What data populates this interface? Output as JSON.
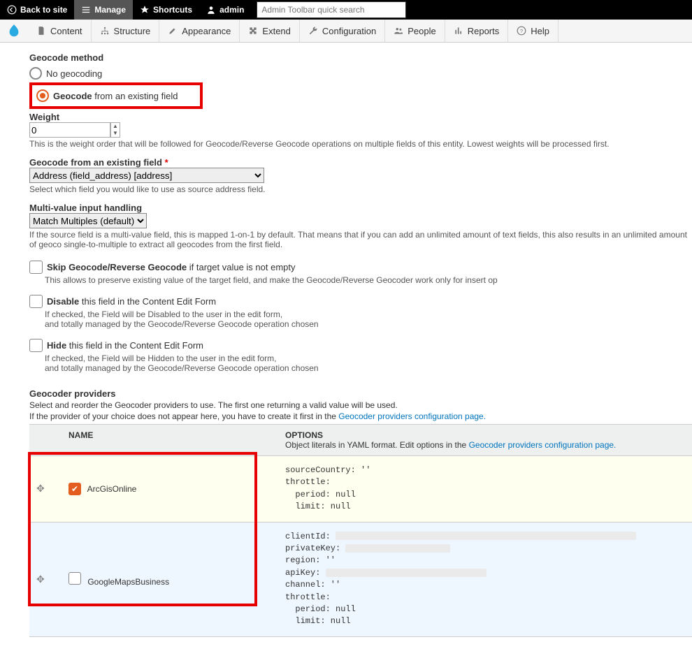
{
  "adminBar": {
    "back": "Back to site",
    "manage": "Manage",
    "shortcuts": "Shortcuts",
    "user": "admin",
    "searchPlaceholder": "Admin Toolbar quick search"
  },
  "tabs": {
    "content": "Content",
    "structure": "Structure",
    "appearance": "Appearance",
    "extend": "Extend",
    "configuration": "Configuration",
    "people": "People",
    "reports": "Reports",
    "help": "Help"
  },
  "geocodeMethod": {
    "label": "Geocode method",
    "noGeocoding": "No geocoding",
    "geocodeStrong": "Geocode",
    "geocodeRest": " from an existing field"
  },
  "weight": {
    "label": "Weight",
    "value": "0",
    "help": "This is the weight order that will be followed for Geocode/Reverse Geocode operations on multiple fields of this entity. Lowest weights will be processed first."
  },
  "sourceField": {
    "label": "Geocode from an existing field ",
    "value": "Address (field_address) [address]",
    "help": "Select which field you would like to use as source address field."
  },
  "multi": {
    "label": "Multi-value input handling",
    "value": "Match Multiples (default)",
    "help": "If the source field is a multi-value field, this is mapped 1-on-1 by default. That means that if you can add an unlimited amount of text fields, this also results in an unlimited amount of geoco single-to-multiple to extract all geocodes from the first field."
  },
  "skip": {
    "strong": "Skip Geocode/Reverse Geocode",
    "rest": " if target value is not empty",
    "help": "This allows to preserve existing value of the target field, and make the Geocode/Reverse Geocoder work only for insert op"
  },
  "disable": {
    "strong": "Disable",
    "rest": " this field in the Content Edit Form",
    "help1": "If checked, the Field will be Disabled to the user in the edit form,",
    "help2": "and totally managed by the Geocode/Reverse Geocode operation chosen"
  },
  "hide": {
    "strong": "Hide",
    "rest": " this field in the Content Edit Form",
    "help1": "If checked, the Field will be Hidden to the user in the edit form,",
    "help2": "and totally managed by the Geocode/Reverse Geocode operation chosen"
  },
  "providers": {
    "heading": "Geocoder providers",
    "desc": "Select and reorder the Geocoder providers to use. The first one returning a valid value will be used.",
    "hintPre": "If the provider of your choice does not appear here, you have to create it first in the ",
    "hintLink": "Geocoder providers configuration page.",
    "nameHeader": "NAME",
    "optsHeader": "OPTIONS",
    "optsSub1": "Object literals in YAML format. Edit options in the ",
    "optsSubLink": "Geocoder providers configuration page.",
    "rows": [
      {
        "name": "ArcGisOnline",
        "checked": true,
        "yaml": "sourceCountry: ''\nthrottle:\n  period: null\n  limit: null"
      },
      {
        "name": "GoogleMapsBusiness",
        "checked": false,
        "yaml": "clientId:\nprivateKey:\nregion: ''\napiKey:\nchannel: ''\nthrottle:\n  period: null\n  limit: null"
      }
    ]
  }
}
